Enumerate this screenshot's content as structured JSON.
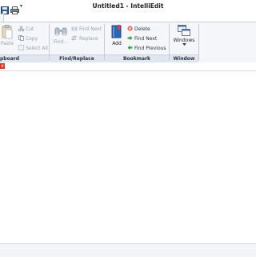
{
  "window": {
    "title": "Untitled1 - IntelliEdit"
  },
  "quick_access": {
    "save_icon": "floppy-disk-icon",
    "print_icon": "printer-icon",
    "dropdown_glyph": "▾"
  },
  "ribbon": {
    "clipboard": {
      "label": "pboard",
      "paste": "Paste",
      "cut": "Cut",
      "copy": "Copy",
      "select_all": "Select All"
    },
    "find_replace": {
      "label": "Find/Replace",
      "find": "Find...",
      "find_next": "Find Next",
      "replace": "Replace"
    },
    "bookmark": {
      "label": "Bookmark",
      "add": "Add",
      "delete": "Delete",
      "find_next": "Find Next",
      "find_previous": "Find Previous"
    },
    "window": {
      "label": "Window",
      "windows": "Windows"
    }
  },
  "doc_tab": {
    "close_glyph": "x"
  },
  "colors": {
    "accent": "#2b5797",
    "close": "#d23a2a",
    "delete": "#d9534f",
    "green": "#2e9e3e"
  }
}
